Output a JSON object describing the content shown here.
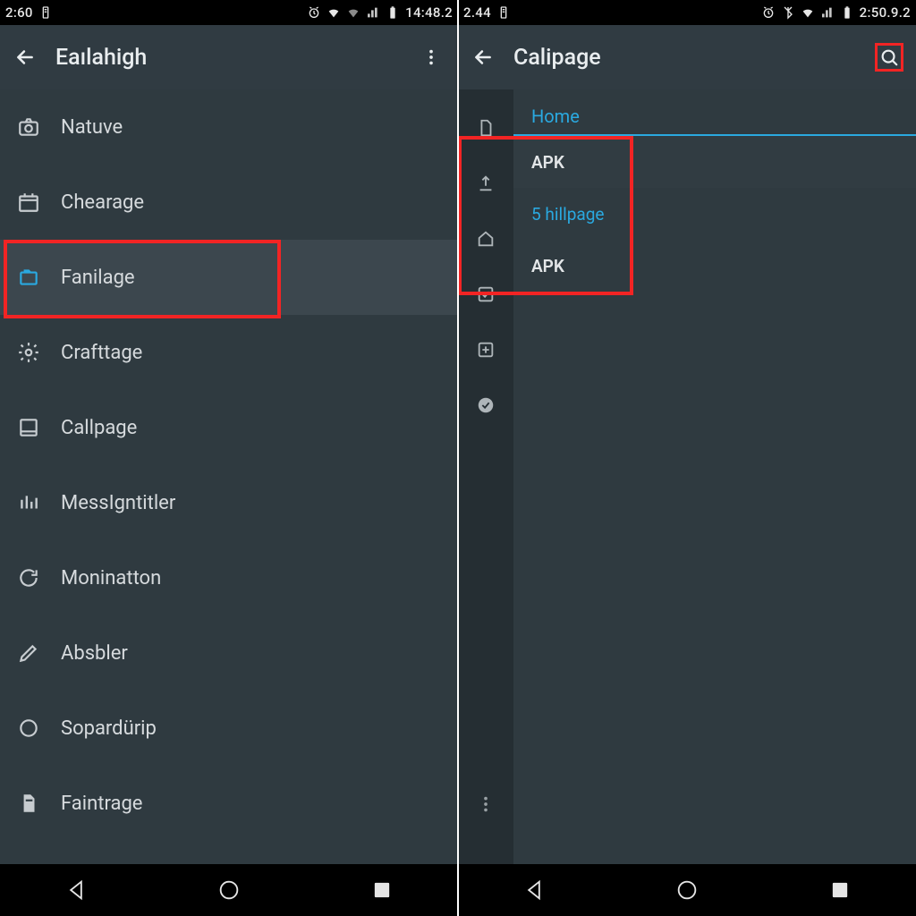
{
  "left": {
    "statusbar": {
      "time_left": "2:60",
      "time_right": "14:48.2"
    },
    "toolbar": {
      "title": "Eaılahigh"
    },
    "items": [
      {
        "icon": "camera-icon",
        "label": "Natuve"
      },
      {
        "icon": "calendar-icon",
        "label": "Chearage"
      },
      {
        "icon": "folder-icon",
        "label": "Fanilage",
        "selected": true
      },
      {
        "icon": "gear-icon",
        "label": "Crafttage"
      },
      {
        "icon": "square-icon",
        "label": "Callpage"
      },
      {
        "icon": "bars-icon",
        "label": "MessIgntitler"
      },
      {
        "icon": "refresh-icon",
        "label": "Moninatton"
      },
      {
        "icon": "pencil-icon",
        "label": "Absbler"
      },
      {
        "icon": "circle-icon",
        "label": "Sopardürip"
      },
      {
        "icon": "file-icon",
        "label": "Faintrage"
      }
    ]
  },
  "right": {
    "statusbar": {
      "time_left": "2.44",
      "time_right": "2:50.9.2"
    },
    "toolbar": {
      "title": "Calipage"
    },
    "tab": {
      "label": "Home"
    },
    "rows": [
      {
        "label": "APK",
        "variant": "alt"
      },
      {
        "label": "5 hillpage",
        "variant": "link"
      },
      {
        "label": "APK",
        "variant": ""
      }
    ],
    "sidebar_icons": [
      "file-icon",
      "upload-icon",
      "home-icon",
      "check-icon",
      "plus-icon",
      "check-circle-icon"
    ]
  },
  "colors": {
    "accent": "#2aa9e0",
    "highlight": "#f22424"
  }
}
